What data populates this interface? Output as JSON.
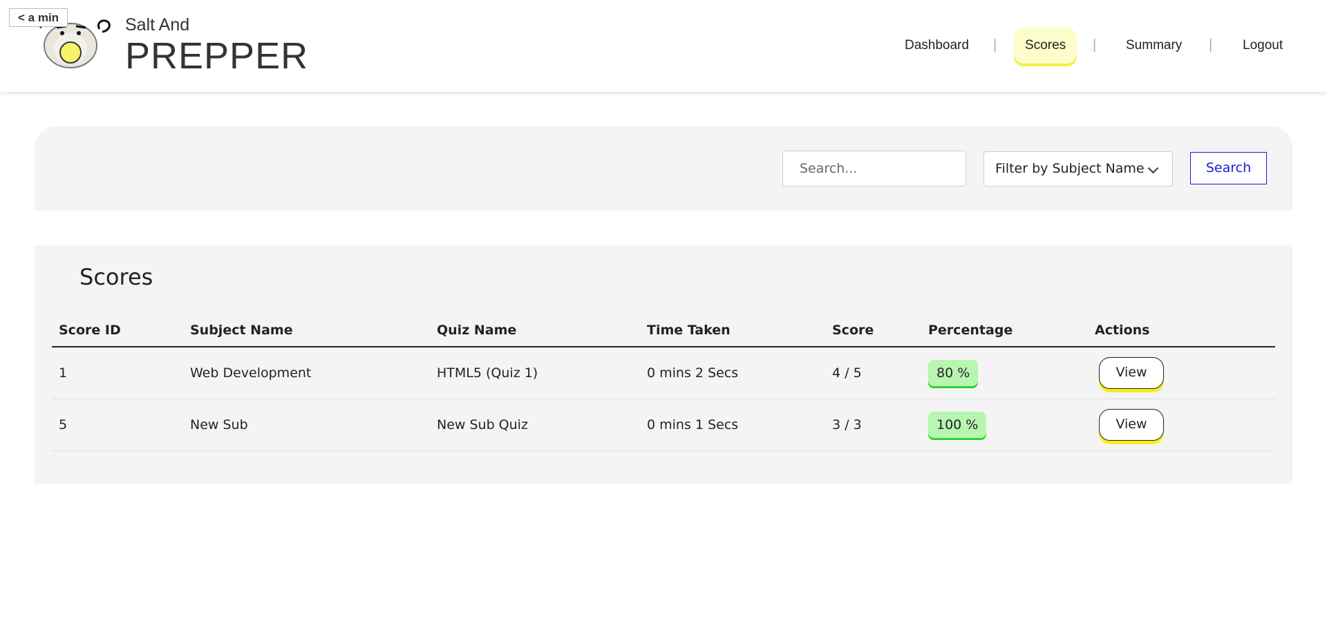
{
  "header": {
    "timer_label": "< a min",
    "logo_small": "Salt And",
    "logo_big": "PREPPER",
    "nav": [
      {
        "label": "Dashboard"
      },
      {
        "label": "Scores"
      },
      {
        "label": "Summary"
      },
      {
        "label": "Logout"
      }
    ],
    "nav_separator": "|"
  },
  "filters": {
    "search_placeholder": "Search...",
    "subject_select_value": "Filter by Subject Name",
    "search_button": "Search"
  },
  "scores": {
    "title": "Scores",
    "columns": [
      "Score ID",
      "Subject Name",
      "Quiz Name",
      "Time Taken",
      "Score",
      "Percentage",
      "Actions"
    ],
    "rows": [
      {
        "id": "1",
        "subject": "Web Development",
        "quiz": "HTML5 (Quiz 1)",
        "time": "0 mins 2 Secs",
        "score": "4 / 5",
        "percentage": "80 %",
        "action": "View"
      },
      {
        "id": "5",
        "subject": "New Sub",
        "quiz": "New Sub Quiz",
        "time": "0 mins 1 Secs",
        "score": "3 / 3",
        "percentage": "100 %",
        "action": "View"
      }
    ]
  },
  "colors": {
    "active_nav_bg": "#fdfccb",
    "active_nav_underline": "#f2ef3c",
    "percentage_bg": "#b8f5b0",
    "percentage_shadow": "#2fd12f",
    "view_button_shadow": "#f4ee17",
    "search_button": "#1a1ad6"
  },
  "icons": {
    "logo": "egg-mascot-icon",
    "select": "chevron-down-icon"
  }
}
